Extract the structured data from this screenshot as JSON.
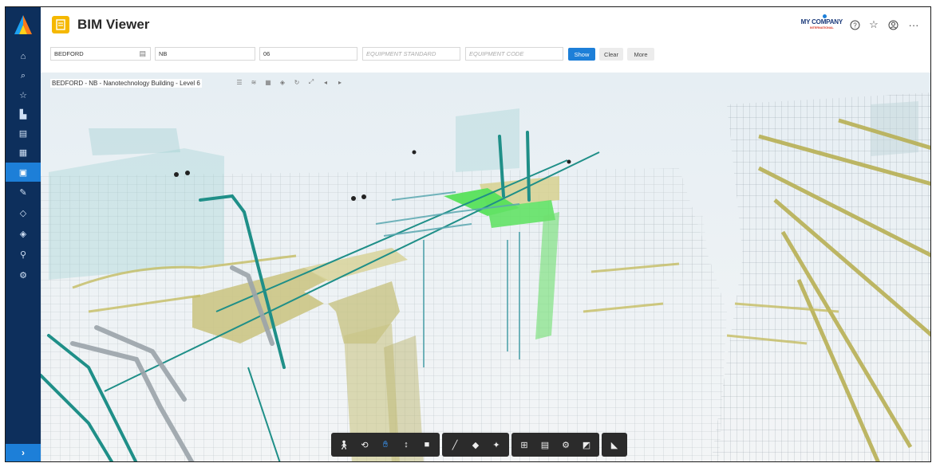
{
  "app": {
    "title": "BIM Viewer",
    "company": "MY COMPANY",
    "company_tagline": "INTERNATIONAL"
  },
  "colors": {
    "sidebar": "#0d2f5c",
    "accent": "#1d7fd8",
    "app_icon": "#f5b800",
    "toolbar": "#2b2b2b",
    "duct": "#c9c57a",
    "pipe": "#1e8f8a",
    "highlight": "#4cdc4c"
  },
  "sidebar": {
    "items": [
      {
        "icon": "home-icon"
      },
      {
        "icon": "search-icon"
      },
      {
        "icon": "star-icon"
      },
      {
        "icon": "buildings-icon"
      },
      {
        "icon": "report-icon"
      },
      {
        "icon": "grid-icon"
      },
      {
        "icon": "document-icon",
        "active": true
      },
      {
        "icon": "wrench-icon"
      },
      {
        "icon": "tag-icon"
      },
      {
        "icon": "diamond-icon"
      },
      {
        "icon": "pin-icon"
      },
      {
        "icon": "settings-icon"
      }
    ],
    "expand_icon": "chevron-right-icon"
  },
  "header_icons": [
    "help-icon",
    "favorite-icon",
    "account-icon",
    "more-icon"
  ],
  "filters": {
    "site": "BEDFORD",
    "building": "NB",
    "level": "06",
    "equipment_standard_placeholder": "EQUIPMENT STANDARD",
    "equipment_code_placeholder": "EQUIPMENT CODE",
    "show_label": "Show",
    "clear_label": "Clear",
    "more_label": "More"
  },
  "viewer": {
    "breadcrumb": "BEDFORD - NB - Nanotechnology Building - Level 6",
    "tools": [
      "list-icon",
      "layers-icon",
      "model-icon",
      "shape-icon",
      "rotate-icon",
      "fit-icon",
      "back-icon",
      "forward-icon"
    ]
  },
  "toolbar": {
    "groups": [
      [
        "walk-icon",
        "orbit-icon",
        "pan-icon",
        "zoom-icon",
        "camera-icon"
      ],
      [
        "measure-icon",
        "section-icon",
        "explode-icon"
      ],
      [
        "model-tree-icon",
        "properties-icon",
        "settings-icon",
        "fullscreen-icon"
      ],
      [
        "tag-icon"
      ]
    ]
  }
}
